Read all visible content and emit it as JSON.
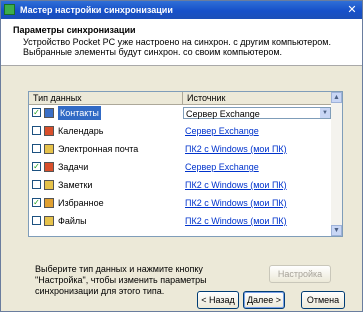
{
  "window": {
    "title": "Мастер настройки синхронизации"
  },
  "header": {
    "title": "Параметры синхронизации",
    "description": "Устройство Pocket PC уже настроено на синхрон. с другим компьютером. Выбранные элементы будут синхрон. со своим компьютером."
  },
  "table": {
    "col_type": "Тип данных",
    "col_source": "Источник",
    "rows": [
      {
        "checked": true,
        "name": "Контакты",
        "source": "Сервер Exchange",
        "icon": "contacts-icon",
        "icon_color": "#3a6fc7"
      },
      {
        "checked": false,
        "name": "Календарь",
        "source": "Сервер Exchange",
        "icon": "calendar-icon",
        "icon_color": "#d94f2b"
      },
      {
        "checked": false,
        "name": "Электронная почта",
        "source": "ПК2 с Windows (мои ПК)",
        "icon": "mail-icon",
        "icon_color": "#e6c24a"
      },
      {
        "checked": true,
        "name": "Задачи",
        "source": "Сервер Exchange",
        "icon": "tasks-icon",
        "icon_color": "#d94f2b"
      },
      {
        "checked": false,
        "name": "Заметки",
        "source": "ПК2 с Windows (мои ПК)",
        "icon": "notes-icon",
        "icon_color": "#e6c24a"
      },
      {
        "checked": true,
        "name": "Избранное",
        "source": "ПК2 с Windows (мои ПК)",
        "icon": "favorites-icon",
        "icon_color": "#e0a030"
      },
      {
        "checked": false,
        "name": "Файлы",
        "source": "ПК2 с Windows (мои ПК)",
        "icon": "files-icon",
        "icon_color": "#e6c24a"
      }
    ]
  },
  "hint": "Выберите тип данных и нажмите кнопку \"Настройка\", чтобы изменить параметры синхронизации для этого типа.",
  "buttons": {
    "settings": "Настройка",
    "back": "< Назад",
    "next": "Далее >",
    "cancel": "Отмена"
  },
  "colors": {
    "titlebar": "#1650c9",
    "selection": "#316ac5",
    "link": "#0033cc"
  }
}
